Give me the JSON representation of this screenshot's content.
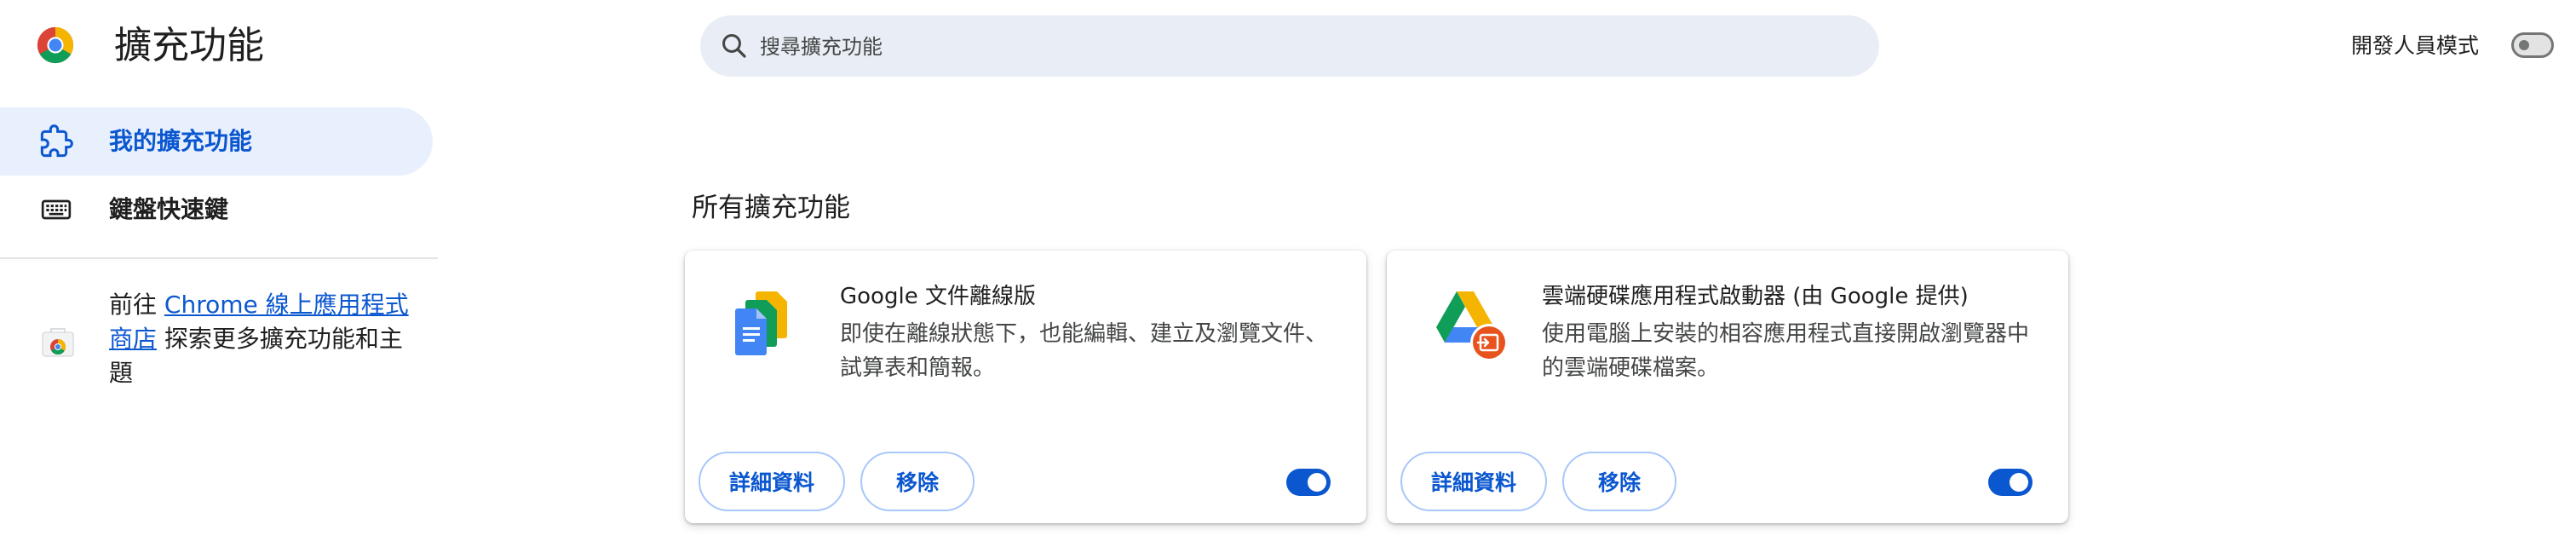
{
  "header": {
    "title": "擴充功能",
    "search_placeholder": "搜尋擴充功能",
    "search_value": "",
    "dev_mode_label": "開發人員模式",
    "dev_mode_on": false
  },
  "sidebar": {
    "items": [
      {
        "label": "我的擴充功能",
        "icon": "extension-icon",
        "active": true
      },
      {
        "label": "鍵盤快速鍵",
        "icon": "keyboard-icon",
        "active": false
      }
    ],
    "store": {
      "prefix": "前往 ",
      "link": "Chrome 線上應用程式商店",
      "suffix": " 探索更多擴充功能和主題"
    }
  },
  "main": {
    "section_title": "所有擴充功能",
    "extensions": [
      {
        "name": "Google 文件離線版",
        "description": "即使在離線狀態下，也能編輯、建立及瀏覽文件、試算表和簡報。",
        "details_label": "詳細資料",
        "remove_label": "移除",
        "enabled": true,
        "icon": "google-docs-offline-icon"
      },
      {
        "name": "雲端硬碟應用程式啟動器 (由 Google 提供)",
        "description": "使用電腦上安裝的相容應用程式直接開啟瀏覽器中的雲端硬碟檔案。",
        "details_label": "詳細資料",
        "remove_label": "移除",
        "enabled": true,
        "icon": "drive-app-launcher-icon"
      }
    ]
  },
  "colors": {
    "accent": "#0b57d0",
    "active_nav_bg": "#d3e3fd",
    "search_bg": "#e9eef6"
  }
}
